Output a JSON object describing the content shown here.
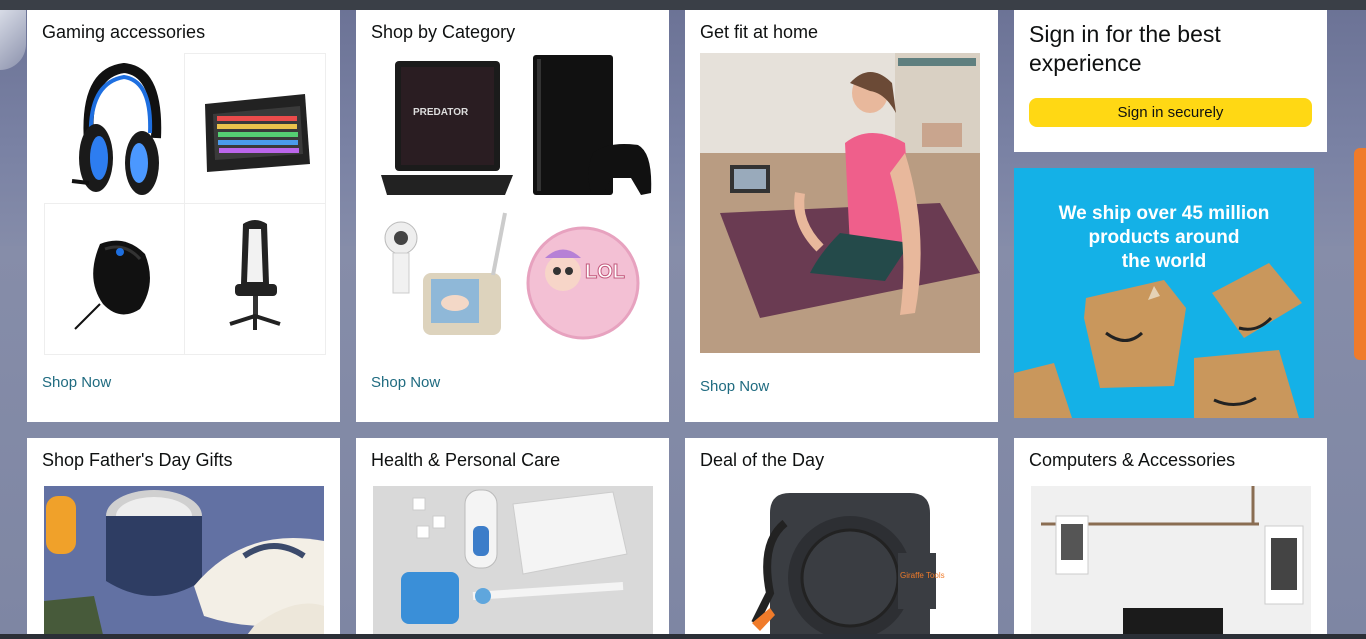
{
  "cards_top": [
    {
      "title": "Gaming accessories",
      "link": "Shop Now"
    },
    {
      "title": "Shop by Category",
      "link": "Shop Now"
    },
    {
      "title": "Get fit at home",
      "link": "Shop Now"
    }
  ],
  "signin": {
    "title": "Sign in for the best experience",
    "button": "Sign in securely"
  },
  "ad": {
    "text": "We ship over 45 million\nproducts around\nthe world"
  },
  "cards_bottom": [
    {
      "title": "Shop Father's Day Gifts"
    },
    {
      "title": "Health & Personal Care"
    },
    {
      "title": "Deal of the Day"
    },
    {
      "title": "Computers & Accessories"
    }
  ],
  "deal_brand": "Giraffe Tools",
  "colors": {
    "accent_yellow": "#ffd814",
    "link_teal": "#1f6b80",
    "ad_blue": "#14b1e7",
    "scroll_orange": "#f07b2a"
  }
}
